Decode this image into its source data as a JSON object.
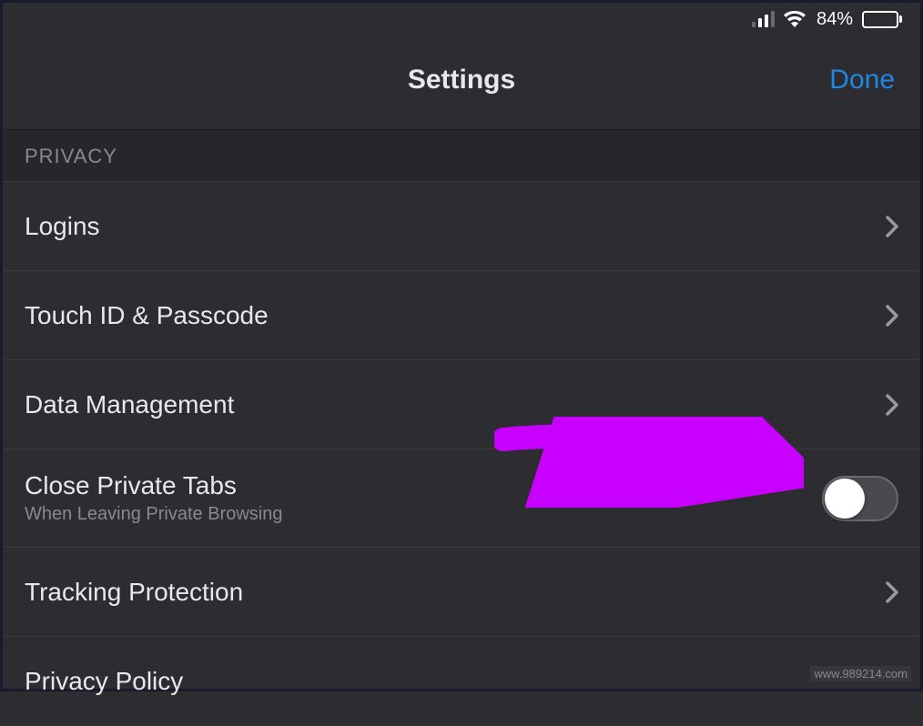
{
  "statusBar": {
    "batteryPercent": "84%"
  },
  "nav": {
    "title": "Settings",
    "done": "Done"
  },
  "section": {
    "header": "PRIVACY",
    "rows": {
      "logins": "Logins",
      "touchId": "Touch ID & Passcode",
      "dataMgmt": "Data Management",
      "closePrivate": "Close Private Tabs",
      "closePrivateSub": "When Leaving Private Browsing",
      "tracking": "Tracking Protection",
      "privacyPolicy": "Privacy Policy"
    }
  },
  "watermark": "www.989214.com"
}
